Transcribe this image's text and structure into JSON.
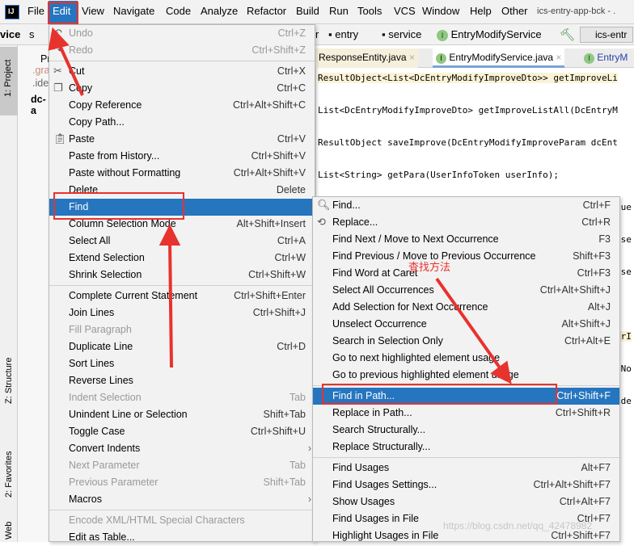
{
  "menubar": {
    "items": [
      "File",
      "Edit",
      "View",
      "Navigate",
      "Code",
      "Analyze",
      "Refactor",
      "Build",
      "Run",
      "Tools",
      "VCS",
      "Window",
      "Help",
      "Other"
    ],
    "title": "ics-entry-app-bck - ."
  },
  "navbar": {
    "left_crumb": "vice",
    "left_folder": "s",
    "crumbs": [
      "r",
      "entry",
      "service",
      "EntryModifyService"
    ],
    "run_config": "ics-entr"
  },
  "sidebar": {
    "project_label": "1: Project",
    "structure_label": "Z: Structure",
    "favorites_label": "2: Favorites",
    "web_label": "Web",
    "tree": [
      "Pr",
      ".gra",
      ".ide",
      "dc-a"
    ]
  },
  "tabs": [
    {
      "label": "ResponseEntity.java"
    },
    {
      "label": "EntryModifyService.java"
    },
    {
      "label": "EntryM"
    }
  ],
  "code": [
    "ResultObject<List<DcEntryModifyImproveDto>> getImproveLi",
    "List<DcEntryModifyImproveDto> getImproveListAll(DcEntryM",
    "ResultObject saveImprove(DcEntryModifyImproveParam dcEnt",
    "List<String> getPara(UserInfoToken userInfo);"
  ],
  "code_right_fragments": [
    "que",
    "use",
    "use",
    "erI",
    "gNo",
    "ade"
  ],
  "edit_menu": [
    {
      "label": "Undo",
      "shortcut": "Ctrl+Z",
      "disabled": true,
      "icon": "undo-icon"
    },
    {
      "label": "Redo",
      "shortcut": "Ctrl+Shift+Z",
      "disabled": true,
      "icon": "redo-icon"
    },
    {
      "sep": true
    },
    {
      "label": "Cut",
      "shortcut": "Ctrl+X",
      "icon": "scissors-icon"
    },
    {
      "label": "Copy",
      "shortcut": "Ctrl+C",
      "icon": "copy-icon"
    },
    {
      "label": "Copy Reference",
      "shortcut": "Ctrl+Alt+Shift+C"
    },
    {
      "label": "Copy Path...",
      "shortcut": ""
    },
    {
      "label": "Paste",
      "shortcut": "Ctrl+V",
      "icon": "clipboard-icon"
    },
    {
      "label": "Paste from History...",
      "shortcut": "Ctrl+Shift+V"
    },
    {
      "label": "Paste without Formatting",
      "shortcut": "Ctrl+Alt+Shift+V"
    },
    {
      "label": "Delete",
      "shortcut": "Delete"
    },
    {
      "label": "Find",
      "shortcut": "",
      "submenu": true,
      "selected": true
    },
    {
      "label": "Column Selection Mode",
      "shortcut": "Alt+Shift+Insert"
    },
    {
      "label": "Select All",
      "shortcut": "Ctrl+A"
    },
    {
      "label": "Extend Selection",
      "shortcut": "Ctrl+W"
    },
    {
      "label": "Shrink Selection",
      "shortcut": "Ctrl+Shift+W"
    },
    {
      "sep": true
    },
    {
      "label": "Complete Current Statement",
      "shortcut": "Ctrl+Shift+Enter"
    },
    {
      "label": "Join Lines",
      "shortcut": "Ctrl+Shift+J"
    },
    {
      "label": "Fill Paragraph",
      "shortcut": "",
      "disabled": true
    },
    {
      "label": "Duplicate Line",
      "shortcut": "Ctrl+D"
    },
    {
      "label": "Sort Lines",
      "shortcut": ""
    },
    {
      "label": "Reverse Lines",
      "shortcut": ""
    },
    {
      "label": "Indent Selection",
      "shortcut": "Tab",
      "disabled": true
    },
    {
      "label": "Unindent Line or Selection",
      "shortcut": "Shift+Tab"
    },
    {
      "label": "Toggle Case",
      "shortcut": "Ctrl+Shift+U"
    },
    {
      "label": "Convert Indents",
      "shortcut": "",
      "submenu": true
    },
    {
      "label": "Next Parameter",
      "shortcut": "Tab",
      "disabled": true
    },
    {
      "label": "Previous Parameter",
      "shortcut": "Shift+Tab",
      "disabled": true
    },
    {
      "label": "Macros",
      "shortcut": "",
      "submenu": true
    },
    {
      "sep": true
    },
    {
      "label": "Encode XML/HTML Special Characters",
      "shortcut": "",
      "disabled": true
    },
    {
      "label": "Edit as Table...",
      "shortcut": ""
    }
  ],
  "find_submenu": [
    {
      "label": "Find...",
      "shortcut": "Ctrl+F",
      "icon": "search-icon"
    },
    {
      "label": "Replace...",
      "shortcut": "Ctrl+R",
      "icon": "replace-icon"
    },
    {
      "label": "Find Next / Move to Next Occurrence",
      "shortcut": "F3"
    },
    {
      "label": "Find Previous / Move to Previous Occurrence",
      "shortcut": "Shift+F3"
    },
    {
      "label": "Find Word at Caret",
      "shortcut": "Ctrl+F3"
    },
    {
      "label": "Select All Occurrences",
      "shortcut": "Ctrl+Alt+Shift+J"
    },
    {
      "label": "Add Selection for Next Occurrence",
      "shortcut": "Alt+J"
    },
    {
      "label": "Unselect Occurrence",
      "shortcut": "Alt+Shift+J"
    },
    {
      "label": "Search in Selection Only",
      "shortcut": "Ctrl+Alt+E"
    },
    {
      "label": "Go to next highlighted element usage",
      "shortcut": ""
    },
    {
      "label": "Go to previous highlighted element usage",
      "shortcut": ""
    },
    {
      "sep": true
    },
    {
      "label": "Find in Path...",
      "shortcut": "Ctrl+Shift+F",
      "selected": true
    },
    {
      "label": "Replace in Path...",
      "shortcut": "Ctrl+Shift+R"
    },
    {
      "label": "Search Structurally...",
      "shortcut": ""
    },
    {
      "label": "Replace Structurally...",
      "shortcut": ""
    },
    {
      "sep": true
    },
    {
      "label": "Find Usages",
      "shortcut": "Alt+F7"
    },
    {
      "label": "Find Usages Settings...",
      "shortcut": "Ctrl+Alt+Shift+F7"
    },
    {
      "label": "Show Usages",
      "shortcut": "Ctrl+Alt+F7"
    },
    {
      "label": "Find Usages in File",
      "shortcut": "Ctrl+F7"
    },
    {
      "label": "Highlight Usages in File",
      "shortcut": "Ctrl+Shift+F7"
    }
  ],
  "annotation": {
    "note": "查找方法",
    "color": "#e8322e"
  },
  "watermark": "https://blog.csdn.net/qq_42478982",
  "colors": {
    "selection": "#2675bf",
    "menu_bg": "#f2f2f2"
  }
}
